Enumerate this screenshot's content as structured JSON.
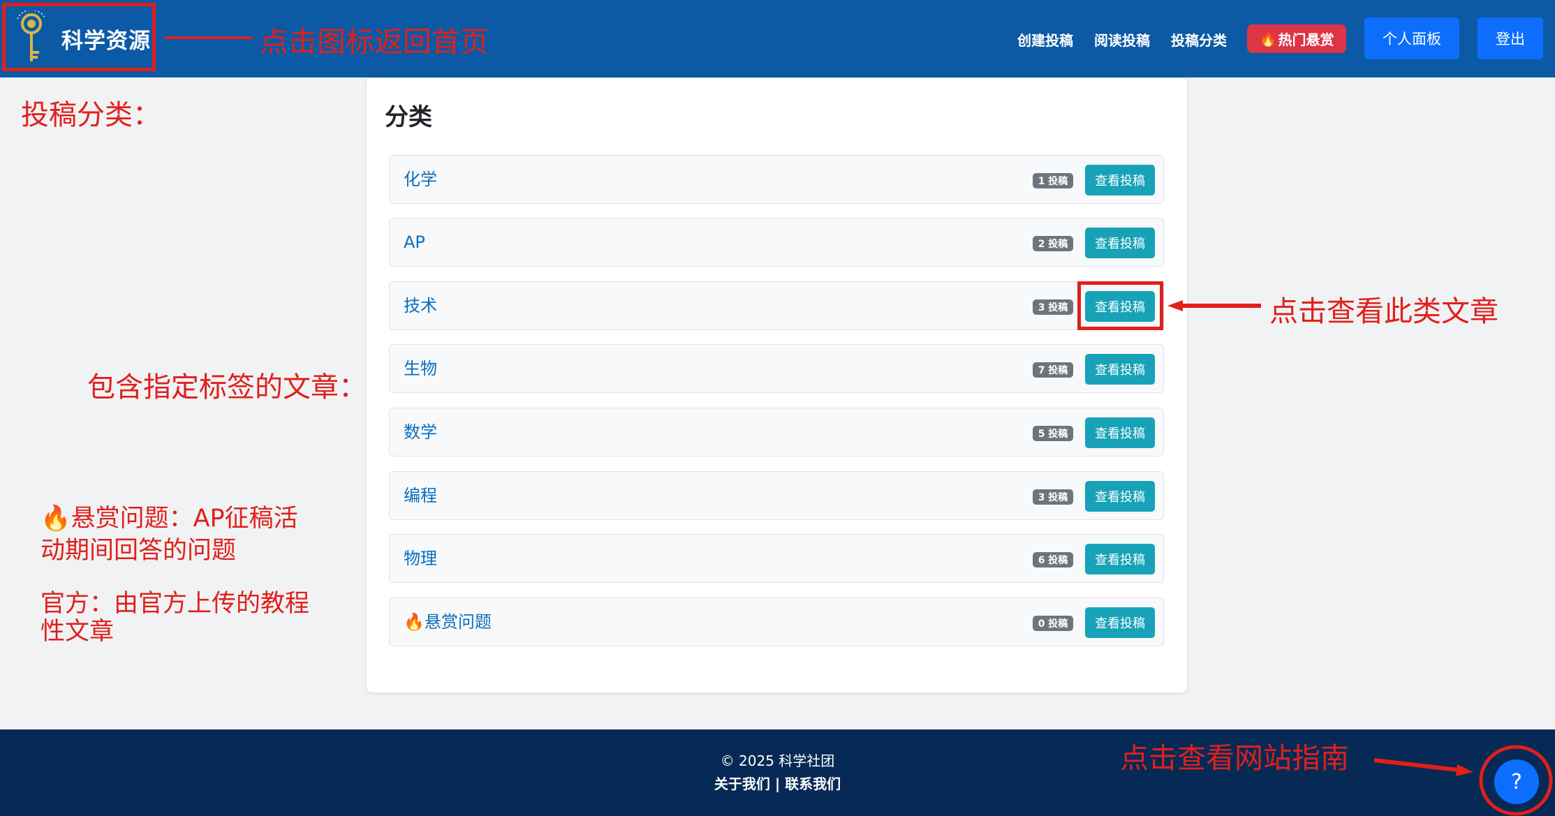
{
  "header": {
    "brand_name": "科学资源",
    "nav": {
      "create": "创建投稿",
      "read": "阅读投稿",
      "categories": "投稿分类",
      "hot_bounty": "热门悬赏"
    },
    "dashboard_button": "个人面板",
    "logout_button": "登出",
    "colors": {
      "header_bg": "#0c5aa6",
      "primary": "#0d6efd",
      "danger": "#dc3545"
    }
  },
  "card": {
    "title": "分类",
    "view_button_label": "查看投稿",
    "categories": [
      {
        "name": "化学",
        "badge": "1 投稿"
      },
      {
        "name": "AP",
        "badge": "2 投稿"
      },
      {
        "name": "技术",
        "badge": "3 投稿"
      },
      {
        "name": "生物",
        "badge": "7 投稿"
      },
      {
        "name": "数学",
        "badge": "5 投稿"
      },
      {
        "name": "编程",
        "badge": "3 投稿"
      },
      {
        "name": "物理",
        "badge": "6 投稿"
      },
      {
        "name": "悬赏问题",
        "badge": "0 投稿"
      }
    ]
  },
  "footer": {
    "copyright": "© 2025 科学社团",
    "links": "关于我们 | 联系我们",
    "help_button": "?"
  },
  "annotations": {
    "logo_hint": "点击图标返回首页",
    "categories_heading": "投稿分类：",
    "tags_heading": "包含指定标签的文章：",
    "bounty_line1": "悬赏问题：AP征稿活",
    "bounty_line2": "动期间回答的问题",
    "official_line1": "官方：由官方上传的教程",
    "official_line2": "性文章",
    "view_hint": "点击查看此类文章",
    "guide_hint": "点击查看网站指南",
    "color": "#e0201b"
  }
}
